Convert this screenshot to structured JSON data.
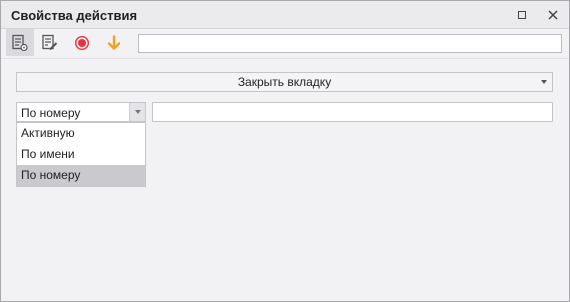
{
  "window": {
    "title": "Свойства действия"
  },
  "toolbar": {
    "buttons": [
      {
        "icon": "action-properties-icon",
        "active": true
      },
      {
        "icon": "edit-note-icon",
        "active": false
      },
      {
        "icon": "record-icon",
        "color": "#e8333a"
      },
      {
        "icon": "arrow-down-icon",
        "color": "#f0a31c"
      }
    ],
    "input_value": ""
  },
  "action": {
    "selected": "Закрыть вкладку"
  },
  "mode": {
    "selected": "По номеру",
    "options": [
      "Активную",
      "По имени",
      "По номеру"
    ],
    "highlighted_index": 2
  },
  "value_input": ""
}
